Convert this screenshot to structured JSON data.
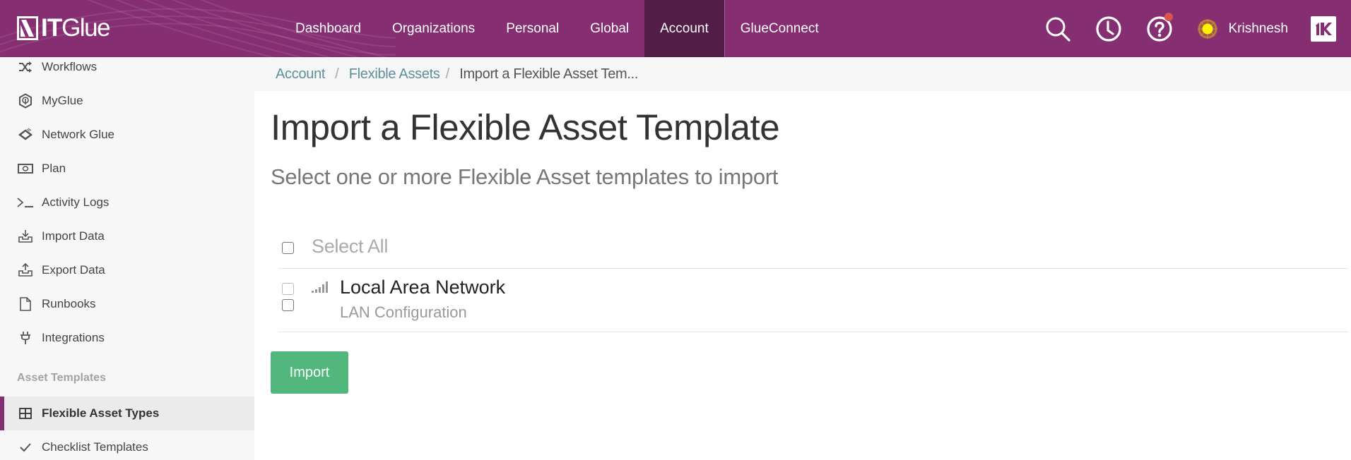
{
  "header": {
    "logo": {
      "it": "IT",
      "glue": "Glue"
    },
    "nav": [
      {
        "label": "Dashboard",
        "active": false
      },
      {
        "label": "Organizations",
        "active": false
      },
      {
        "label": "Personal",
        "active": false
      },
      {
        "label": "Global",
        "active": false
      },
      {
        "label": "Account",
        "active": true
      },
      {
        "label": "GlueConnect",
        "active": false
      }
    ],
    "icons": [
      "search-icon",
      "history-clock-icon",
      "help-icon"
    ],
    "help_has_notification": true,
    "user_name": "Krishnesh",
    "brand_color": "#852f72",
    "active_tab_color": "#521e48"
  },
  "sidebar": {
    "items": [
      {
        "label": "Workflows",
        "icon": "shuffle-icon"
      },
      {
        "label": "MyGlue",
        "icon": "myglue-hexagon-icon"
      },
      {
        "label": "Network Glue",
        "icon": "network-glue-icon"
      },
      {
        "label": "Plan",
        "icon": "money-bill-icon"
      },
      {
        "label": "Activity Logs",
        "icon": "terminal-icon"
      },
      {
        "label": "Import Data",
        "icon": "import-tray-icon"
      },
      {
        "label": "Export Data",
        "icon": "export-tray-icon"
      },
      {
        "label": "Runbooks",
        "icon": "document-icon"
      },
      {
        "label": "Integrations",
        "icon": "plug-icon"
      }
    ],
    "section_label": "Asset Templates",
    "section_items": [
      {
        "label": "Flexible Asset Types",
        "icon": "grid-icon",
        "active": true
      },
      {
        "label": "Checklist Templates",
        "icon": "checkmark-icon",
        "active": false
      }
    ]
  },
  "breadcrumb": {
    "items": [
      {
        "label": "Account",
        "link": true
      },
      {
        "label": "Flexible Assets",
        "link": true
      },
      {
        "label": "Import a Flexible Asset Tem...",
        "link": false
      }
    ],
    "separator": "/"
  },
  "main": {
    "title": "Import a Flexible Asset Template",
    "subtitle": "Select one or more Flexible Asset templates to import",
    "select_all_label": "Select All",
    "select_all_checked": false,
    "templates": [
      {
        "name": "Local Area Network",
        "description": "LAN Configuration",
        "icon": "signal-bars-icon",
        "checked": false
      }
    ],
    "import_button_label": "Import",
    "import_button_color": "#52b77d"
  }
}
